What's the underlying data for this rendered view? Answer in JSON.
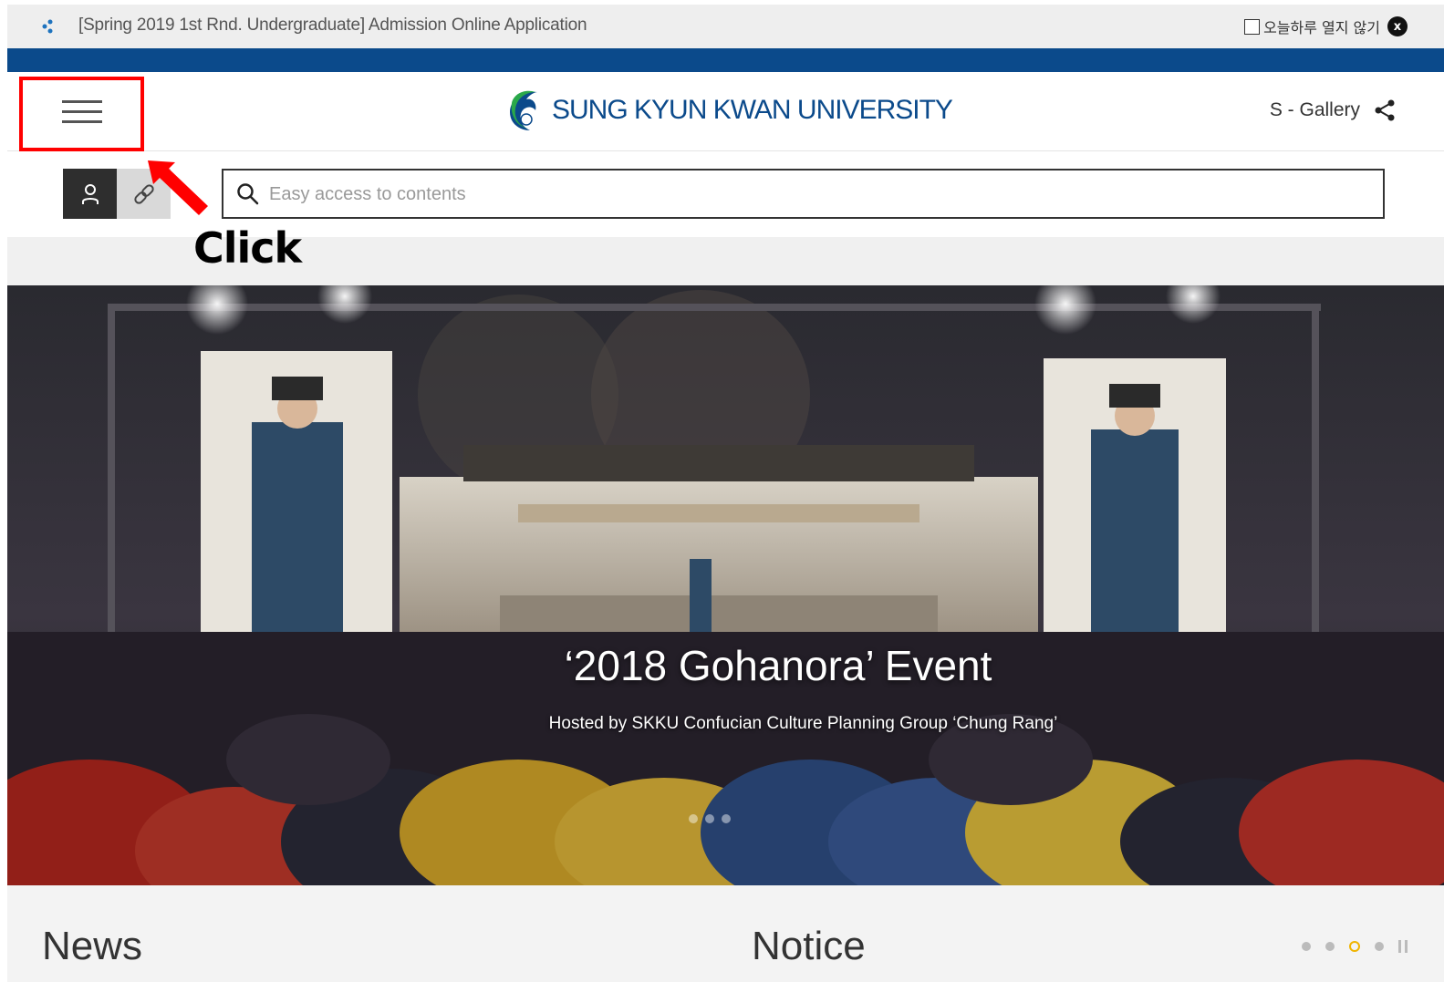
{
  "notice_bar": {
    "text": "[Spring 2019 1st Rnd. Undergraduate] Admission Online Application",
    "dont_open_today_label": "오늘하루 열지 않기",
    "close_glyph": "x"
  },
  "header": {
    "logo_text": "SUNG KYUN KWAN UNIVERSITY",
    "gallery_label": "S - Gallery"
  },
  "search": {
    "placeholder": "Easy access to contents"
  },
  "annotation": {
    "click_label": "Click",
    "highlight_color": "#ff0000"
  },
  "hero": {
    "title": "‘2018 Gohanora’ Event",
    "subtitle": "Hosted by SKKU Confucian Culture Planning Group ‘Chung Rang’"
  },
  "sections": {
    "news_title": "News",
    "notice_title": "Notice"
  },
  "colors": {
    "brand_blue": "#0b4a8b",
    "pager_active": "#f0b400"
  }
}
